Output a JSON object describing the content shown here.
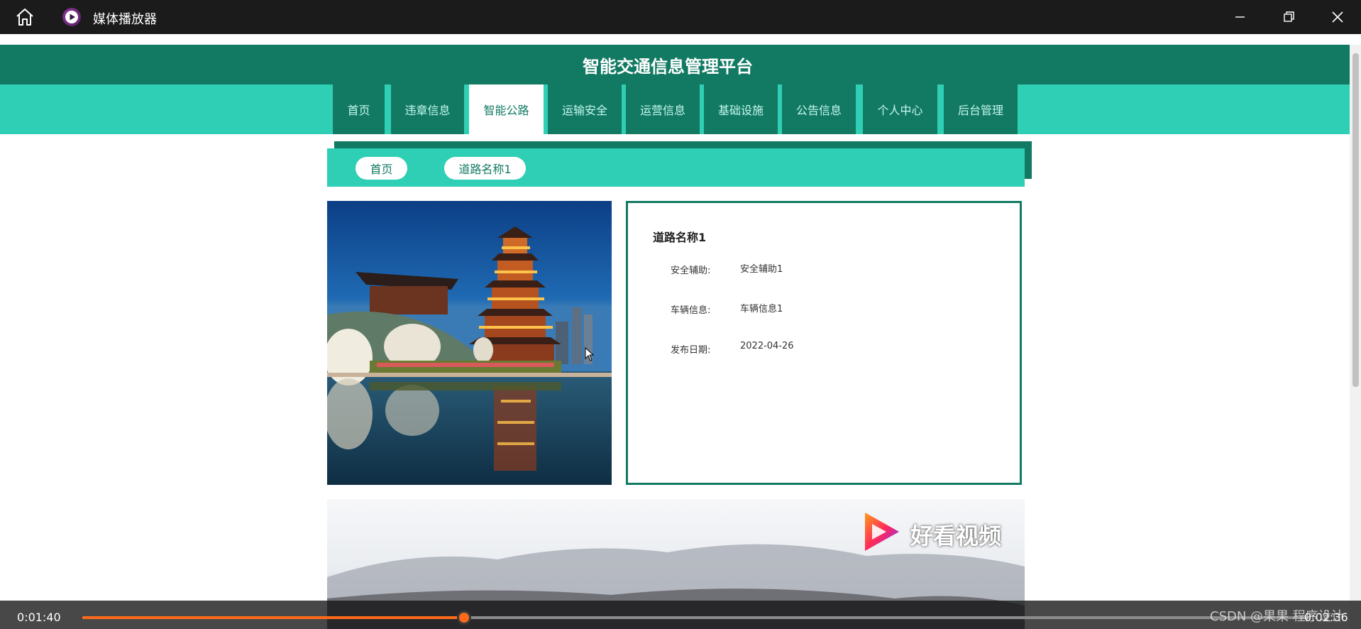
{
  "window": {
    "title": "媒体播放器"
  },
  "site": {
    "title": "智能交通信息管理平台"
  },
  "nav": {
    "items": [
      {
        "label": "首页"
      },
      {
        "label": "违章信息"
      },
      {
        "label": "智能公路"
      },
      {
        "label": "运输安全"
      },
      {
        "label": "运营信息"
      },
      {
        "label": "基础设施"
      },
      {
        "label": "公告信息"
      },
      {
        "label": "个人中心"
      },
      {
        "label": "后台管理"
      }
    ],
    "active": "智能公路"
  },
  "breadcrumb": {
    "home": "首页",
    "current": "道路名称1"
  },
  "detail": {
    "title": "道路名称1",
    "rows": [
      {
        "label": "安全辅助:",
        "value": "安全辅助1"
      },
      {
        "label": "车辆信息:",
        "value": "车辆信息1"
      },
      {
        "label": "发布日期:",
        "value": "2022-04-26"
      }
    ]
  },
  "video_overlay": {
    "logo_text": "好看视频"
  },
  "player": {
    "current_time": "0:01:40",
    "total_time": "0:02:36",
    "progress_fraction": 0.311
  },
  "watermark": "CSDN @果果 程序设计",
  "colors": {
    "header_dark": "#127a63",
    "nav_teal": "#2fcfb5",
    "accent_orange": "#ff6a1a",
    "titlebar": "#1b1b1b"
  }
}
